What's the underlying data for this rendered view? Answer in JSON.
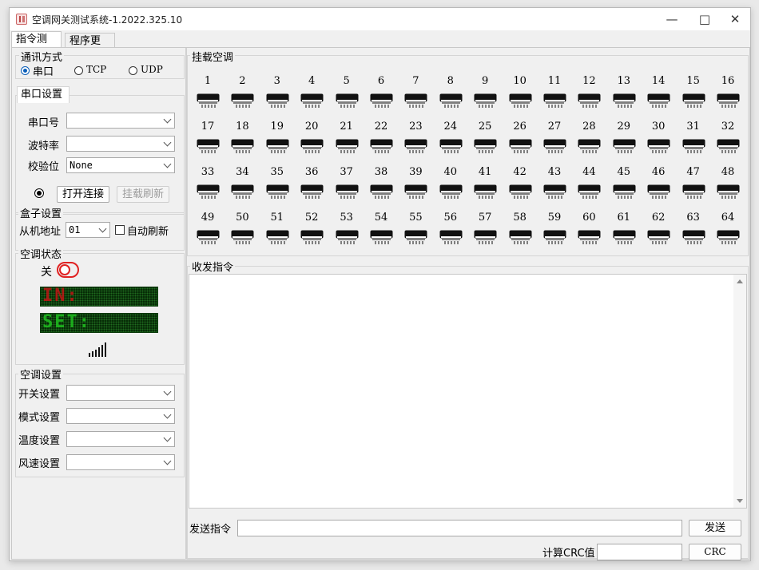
{
  "window": {
    "title": "空调网关测试系统-1.2022.325.10"
  },
  "tabs": [
    {
      "label": "指令测试"
    },
    {
      "label": "程序更新"
    }
  ],
  "comm": {
    "group_label": "通讯方式",
    "options": [
      {
        "label": "串口",
        "checked": true
      },
      {
        "label": "TCP",
        "checked": false
      },
      {
        "label": "UDP",
        "checked": false
      }
    ]
  },
  "serial": {
    "tab_label": "串口设置",
    "port_label": "串口号",
    "port_value": "",
    "baud_label": "波特率",
    "baud_value": "",
    "parity_label": "校验位",
    "parity_value": "None",
    "open_button": "打开连接",
    "refresh_button": "挂载刷新"
  },
  "box_settings": {
    "group_label": "盒子设置",
    "slave_label": "从机地址",
    "slave_value": "01",
    "auto_refresh_label": "自动刷新"
  },
  "ac_status": {
    "group_label": "空调状态",
    "power_label": "关",
    "in_text": "IN:",
    "set_text": "SET:",
    "colors": {
      "in": "#c01515",
      "set": "#1fc01f"
    }
  },
  "ac_settings": {
    "group_label": "空调设置",
    "rows": [
      {
        "label": "开关设置",
        "value": ""
      },
      {
        "label": "模式设置",
        "value": ""
      },
      {
        "label": "温度设置",
        "value": ""
      },
      {
        "label": "风速设置",
        "value": ""
      }
    ]
  },
  "mounted": {
    "group_label": "挂载空调",
    "units": [
      "1",
      "2",
      "3",
      "4",
      "5",
      "6",
      "7",
      "8",
      "9",
      "10",
      "11",
      "12",
      "13",
      "14",
      "15",
      "16",
      "17",
      "18",
      "19",
      "20",
      "21",
      "22",
      "23",
      "24",
      "25",
      "26",
      "27",
      "28",
      "29",
      "30",
      "31",
      "32",
      "33",
      "34",
      "35",
      "36",
      "37",
      "38",
      "39",
      "40",
      "41",
      "42",
      "43",
      "44",
      "45",
      "46",
      "47",
      "48",
      "49",
      "50",
      "51",
      "52",
      "53",
      "54",
      "55",
      "56",
      "57",
      "58",
      "59",
      "60",
      "61",
      "62",
      "63",
      "64"
    ]
  },
  "cmd": {
    "group_label": "收发指令",
    "send_label": "发送指令",
    "send_button": "发送",
    "crc_label": "计算CRC值",
    "crc_button": "CRC"
  }
}
